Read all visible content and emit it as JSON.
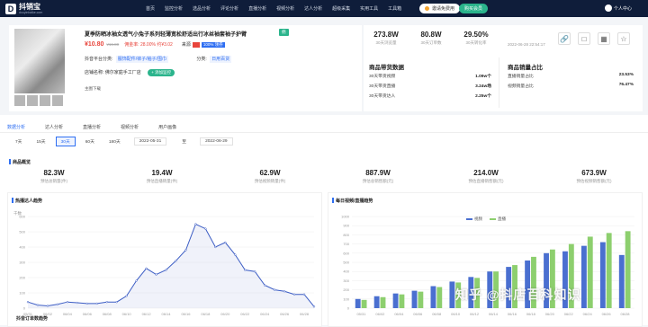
{
  "app": {
    "name": "抖销宝",
    "domain": "douyinbaike.com"
  },
  "nav": [
    "首页",
    "监控分析",
    "选品分析",
    "评论分析",
    "直播分析",
    "视频分析",
    "达人分析",
    "超级采集",
    "实用工具",
    "工具箱"
  ],
  "header": {
    "invite_label": "邀请免费用",
    "vip_label": "购买会员",
    "user_label": "个人中心"
  },
  "product": {
    "title": "夏季防晒冰袖女透气小兔子系列轻薄宽松舒适出行冰丝袖套袖子护臂",
    "tag": "佣",
    "price": "¥10.80",
    "orig_price": "¥16.80",
    "commission": "佣金率: 28.00% 约¥3.02",
    "source_label": "来源",
    "source_badge": "100% 领券",
    "category_label": "抖音平台分类:",
    "category_value": "服饰配件/袜子/袖子/围巾",
    "category2_label": "分类:",
    "category2_value": "日用百货",
    "shop_label": "店铺名称:",
    "shop_name": "佛尔家庭手工厂店",
    "shop_btn": "+ 添加监控",
    "owner": "主图下载"
  },
  "summary": {
    "stats": [
      {
        "value": "273.8W",
        "label": "30天浏览量"
      },
      {
        "value": "80.8W",
        "label": "30天订单数"
      },
      {
        "value": "29.50%",
        "label": "30天转化率"
      }
    ],
    "date": "2022-06-28 22:54:17",
    "icons": [
      "link-icon",
      "wechat-icon",
      "qrcode-icon",
      "star-icon"
    ],
    "product_title": "商品带货数据",
    "product_rows": [
      {
        "label": "30天带货视频",
        "value": "1.09w个"
      },
      {
        "label": "30天带货直播",
        "value": "3.24w场"
      },
      {
        "label": "30天带货达人",
        "value": "2.25w个"
      }
    ],
    "sales_title": "商品销量占比",
    "sales_rows": [
      {
        "label": "直播销量占比",
        "value": "23.53%"
      },
      {
        "label": "视频销量占比",
        "value": "76.47%"
      }
    ]
  },
  "tabs": [
    "数据分析",
    "达人分析",
    "直播分析",
    "视频分析",
    "用户画像"
  ],
  "ranges": [
    "7天",
    "15天",
    "30天",
    "60天",
    "180天"
  ],
  "date_range": {
    "start": "2022-05-31",
    "sep": "至",
    "end": "2022-06-29"
  },
  "overview": {
    "title": "商品概览",
    "metrics": [
      {
        "value": "82.3W",
        "label": "预估总销量(件)"
      },
      {
        "value": "19.4W",
        "label": "预估直播销量(件)"
      },
      {
        "value": "62.9W",
        "label": "预估视频销量(件)"
      },
      {
        "value": "887.9W",
        "label": "预估总销售额(元)"
      },
      {
        "value": "214.0W",
        "label": "预估直播销售额(元)"
      },
      {
        "value": "673.9W",
        "label": "预估视频销售额(元)"
      }
    ]
  },
  "chart_left": {
    "title": "热播达人趋势",
    "unit": "千数"
  },
  "chart_right": {
    "title": "每日视频/直播趋势"
  },
  "bottom_title": "抖音订单数趋势",
  "watermark": "知乎 @抖店百科知识",
  "chart_data": [
    {
      "type": "line",
      "title": "热播达人趋势",
      "ylabel": "千数",
      "categories": [
        "05/31",
        "06/02",
        "06/04",
        "06/06",
        "06/08",
        "06/10",
        "06/12",
        "06/14",
        "06/16",
        "06/18",
        "06/20",
        "06/22",
        "06/24",
        "06/26",
        "06/28"
      ],
      "x": [
        "05/31",
        "06/01",
        "06/02",
        "06/03",
        "06/04",
        "06/05",
        "06/06",
        "06/07",
        "06/08",
        "06/09",
        "06/10",
        "06/11",
        "06/12",
        "06/13",
        "06/14",
        "06/15",
        "06/16",
        "06/17",
        "06/18",
        "06/19",
        "06/20",
        "06/21",
        "06/22",
        "06/23",
        "06/24",
        "06/25",
        "06/26",
        "06/27",
        "06/28",
        "06/29"
      ],
      "values": [
        40,
        20,
        15,
        25,
        40,
        35,
        30,
        30,
        40,
        40,
        80,
        180,
        260,
        220,
        250,
        310,
        380,
        550,
        520,
        400,
        430,
        350,
        250,
        240,
        150,
        120,
        110,
        90,
        90,
        10
      ],
      "ylim": [
        0,
        600
      ],
      "yticks": [
        0,
        100,
        200,
        300,
        400,
        500,
        600
      ],
      "color": "#3b5cc4"
    },
    {
      "type": "bar",
      "title": "每日视频/直播趋势",
      "categories": [
        "05/31",
        "06/02",
        "06/04",
        "06/06",
        "06/08",
        "06/10",
        "06/12",
        "06/14",
        "06/16",
        "06/18",
        "06/20",
        "06/22",
        "06/24",
        "06/26",
        "06/28"
      ],
      "series": [
        {
          "name": "视频",
          "color": "#4a6fd0",
          "values": [
            100,
            130,
            160,
            190,
            240,
            290,
            340,
            400,
            450,
            520,
            600,
            620,
            680,
            720,
            580
          ]
        },
        {
          "name": "直播",
          "color": "#8dcf6e",
          "values": [
            90,
            120,
            150,
            180,
            230,
            280,
            330,
            400,
            470,
            560,
            640,
            700,
            780,
            820,
            840
          ]
        }
      ],
      "ylim": [
        0,
        1000
      ],
      "yticks": [
        0,
        100,
        200,
        300,
        400,
        500,
        600,
        700,
        800,
        900,
        1000
      ]
    }
  ]
}
